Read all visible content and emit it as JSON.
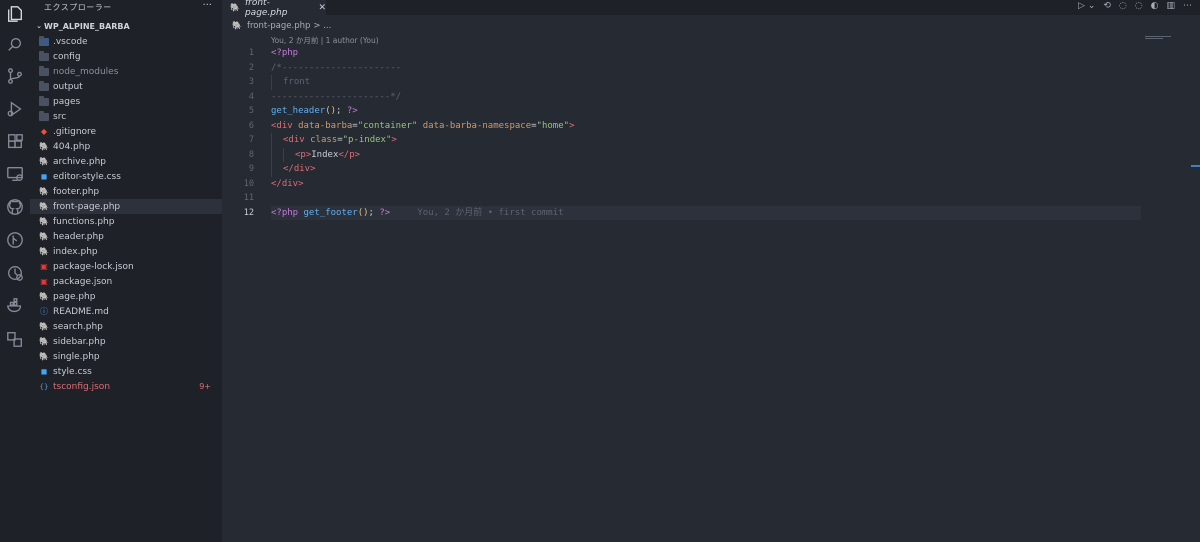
{
  "explorer": {
    "title": "エクスプローラー",
    "more": "···",
    "project": "WP_ALPINE_BARBA",
    "items": [
      {
        "label": ".vscode",
        "kind": "folder-vscode"
      },
      {
        "label": "config",
        "kind": "folder"
      },
      {
        "label": "node_modules",
        "kind": "folder",
        "dim": true
      },
      {
        "label": "output",
        "kind": "folder"
      },
      {
        "label": "pages",
        "kind": "folder"
      },
      {
        "label": "src",
        "kind": "folder"
      },
      {
        "label": ".gitignore",
        "kind": "git"
      },
      {
        "label": "404.php",
        "kind": "php"
      },
      {
        "label": "archive.php",
        "kind": "php"
      },
      {
        "label": "editor-style.css",
        "kind": "css"
      },
      {
        "label": "footer.php",
        "kind": "php"
      },
      {
        "label": "front-page.php",
        "kind": "php",
        "selected": true
      },
      {
        "label": "functions.php",
        "kind": "php"
      },
      {
        "label": "header.php",
        "kind": "php"
      },
      {
        "label": "index.php",
        "kind": "php"
      },
      {
        "label": "package-lock.json",
        "kind": "npm"
      },
      {
        "label": "package.json",
        "kind": "npm"
      },
      {
        "label": "page.php",
        "kind": "php"
      },
      {
        "label": "README.md",
        "kind": "info"
      },
      {
        "label": "search.php",
        "kind": "php"
      },
      {
        "label": "sidebar.php",
        "kind": "php"
      },
      {
        "label": "single.php",
        "kind": "php"
      },
      {
        "label": "style.css",
        "kind": "css"
      },
      {
        "label": "tsconfig.json",
        "kind": "json",
        "error": true,
        "badge": "9+"
      }
    ]
  },
  "tab": {
    "label": "front-page.php",
    "close": "✕"
  },
  "breadcrumb": {
    "file": "front-page.php",
    "rest": "> ..."
  },
  "blame": {
    "top": "You, 2 か月前 | 1 author (You)",
    "inline": "You, 2 か月前 • first commit"
  },
  "editor": {
    "line_numbers": [
      "1",
      "2",
      "3",
      "4",
      "5",
      "6",
      "7",
      "8",
      "9",
      "10",
      "11",
      "12"
    ],
    "current_line": 12,
    "lines": [
      "<?php",
      "/*----------------------",
      "  front",
      "----------------------*/",
      "get_header(); ?>",
      "<div data-barba=\"container\" data-barba-namespace=\"home\">",
      "  <div class=\"p-index\">",
      "    <p>Index</p>",
      "  </div>",
      "</div>",
      "",
      "<?php get_footer(); ?>"
    ]
  },
  "colors": {
    "background": "#262a33",
    "sidebar": "#1e2128",
    "php_icon": "#f07178",
    "error": "#e06c75",
    "keyword": "#c678dd",
    "string": "#98c379",
    "attribute": "#d19a66"
  },
  "activity_icons": [
    "files-icon",
    "search-icon",
    "source-control-icon",
    "run-debug-icon",
    "extensions-icon",
    "remote-explorer-icon",
    "github-icon",
    "git-graph-icon",
    "test-icon",
    "docker-icon",
    "live-share-icon"
  ]
}
